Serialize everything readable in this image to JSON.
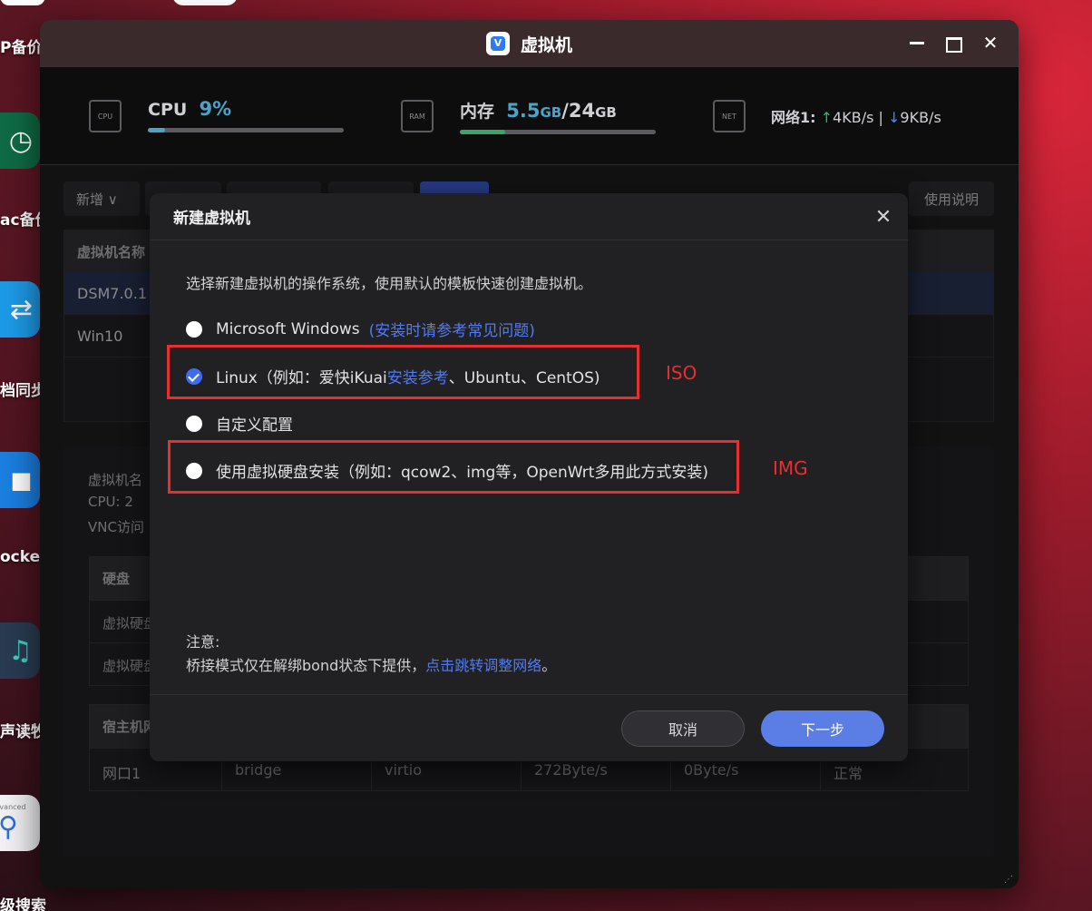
{
  "desktop": {
    "dock_labels": [
      "P备价",
      "ac备价",
      "档同步",
      "ocker",
      "声读牧",
      "级搜索"
    ],
    "dock_tile_small_text": "advanced"
  },
  "window": {
    "title": "虚拟机",
    "logo_letter": "V"
  },
  "stats": {
    "cpu": {
      "label": "CPU",
      "value": "9%",
      "icon_text": "CPU",
      "usage": 0.09
    },
    "ram": {
      "label": "内存",
      "used": "5.5",
      "used_unit": "GB",
      "sep": "/",
      "total": "24",
      "total_unit": "GB",
      "icon_text": "RAM",
      "usage": 0.23
    },
    "net": {
      "label": "网络1:",
      "up": "4KB/s",
      "sep": "|",
      "down": "9KB/s",
      "icon_text": "NET",
      "up_arrow": "↑",
      "down_arrow": "↓"
    }
  },
  "background": {
    "toolbar_add": "新增 ∨",
    "help": "使用说明",
    "table_header": "虚拟机名称",
    "rows": [
      "DSM7.0.1",
      "Win10"
    ],
    "detail_lines": [
      "虚拟机名",
      "CPU: 2",
      "VNC访问"
    ],
    "disk_header": "硬盘",
    "disk_rows": [
      "虚拟硬盘",
      "虚拟硬盘"
    ],
    "net_header": "宿主机网",
    "net_row": [
      "网口1",
      "bridge",
      "virtio",
      "272Byte/s",
      "0Byte/s",
      "正常"
    ]
  },
  "modal": {
    "title": "新建虚拟机",
    "description": "选择新建虚拟机的操作系统，使用默认的模板快速创建虚拟机。",
    "options": [
      {
        "label": "Microsoft Windows",
        "link": "(安装时请参考常见问题)",
        "checked": false
      },
      {
        "label_pre": "Linux（例如：爱快iKuai",
        "link": "安装参考",
        "label_post": "、Ubuntu、CentOS)",
        "checked": true
      },
      {
        "label": "自定义配置",
        "checked": false
      },
      {
        "label": "使用虚拟硬盘安装（例如：qcow2、img等，OpenWrt多用此方式安装)",
        "checked": false
      }
    ],
    "annotations": {
      "iso": "ISO",
      "img": "IMG"
    },
    "note_title": "注意:",
    "note_text": "桥接模式仅在解绑bond状态下提供，",
    "note_link": "点击跳转调整网络",
    "note_end": "。",
    "cancel": "取消",
    "next": "下一步"
  },
  "colors": {
    "accent": "#5b7ee6",
    "link": "#4f7bf7",
    "highlight": "#e6302f",
    "cpu_bar": "#4aa3c9",
    "ram_bar": "#3aa56a"
  }
}
